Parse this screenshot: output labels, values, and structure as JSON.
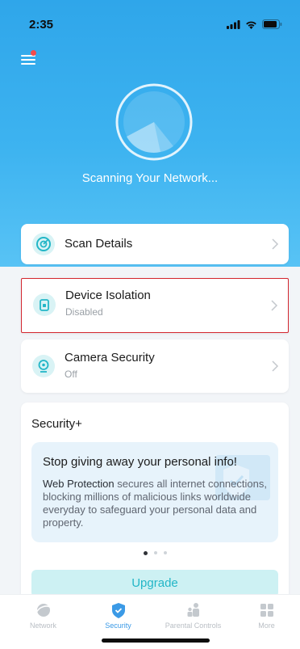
{
  "status_bar": {
    "time": "2:35"
  },
  "hero": {
    "scan_status": "Scanning Your Network..."
  },
  "items": [
    {
      "title": "Scan Details",
      "subtitle": ""
    },
    {
      "title": "Device Isolation",
      "subtitle": "Disabled"
    },
    {
      "title": "Camera Security",
      "subtitle": "Off"
    }
  ],
  "security_plus": {
    "title": "Security+",
    "promo_heading": "Stop giving away your personal info!",
    "promo_bold": "Web Protection",
    "promo_body": " secures all internet connections, blocking millions of malicious links worldwide everyday to safeguard your personal data and property.",
    "carousel_pages": 3,
    "carousel_active": 0,
    "upgrade_label": "Upgrade"
  },
  "tabs": [
    {
      "label": "Network",
      "icon": "network-icon",
      "active": false
    },
    {
      "label": "Security",
      "icon": "shield-icon",
      "active": true
    },
    {
      "label": "Parental Controls",
      "icon": "parental-controls-icon",
      "active": false
    },
    {
      "label": "More",
      "icon": "more-grid-icon",
      "active": false
    }
  ],
  "colors": {
    "hero_top": "#2fa6ea",
    "hero_bottom": "#58c3f5",
    "accent_teal": "#23b6c7",
    "highlight_border": "#d3262e",
    "tab_active": "#3b9ae6",
    "notification_dot": "#f24b4b"
  }
}
